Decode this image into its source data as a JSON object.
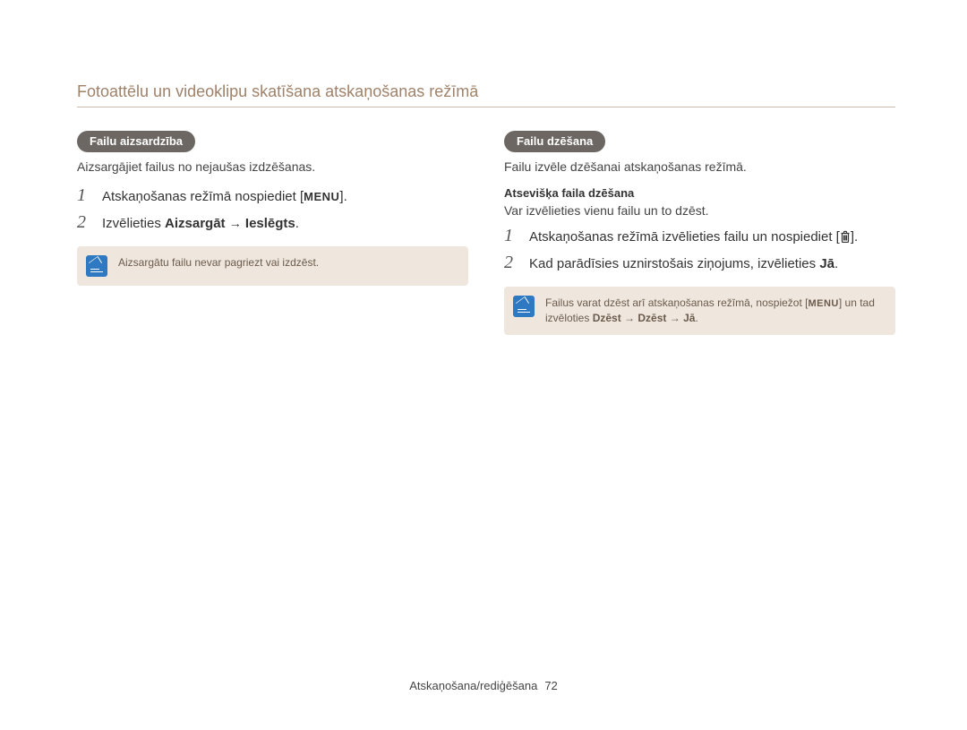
{
  "header": {
    "title": "Fotoattēlu un videoklipu skatīšana atskaņošanas režīmā"
  },
  "left": {
    "pill": "Failu aizsardzība",
    "desc": "Aizsargājiet failus no nejaušas izdzēšanas.",
    "step1_prefix": "Atskaņošanas režīmā nospiediet [",
    "step1_menu": "MENU",
    "step1_suffix": "].",
    "step2_prefix": "Izvēlieties ",
    "step2_strong1": "Aizsargāt",
    "step2_arrow": "→",
    "step2_strong2": "Ieslēgts",
    "step2_suffix": ".",
    "note": "Aizsargātu failu nevar pagriezt vai izdzēst."
  },
  "right": {
    "pill": "Failu dzēšana",
    "desc": "Failu izvēle dzēšanai atskaņošanas režīmā.",
    "subhead": "Atsevišķa faila dzēšana",
    "subdesc": "Var izvēlieties vienu failu un to dzēst.",
    "step1_prefix": "Atskaņošanas režīmā izvēlieties failu un nospiediet [",
    "step1_suffix": "].",
    "step2_prefix": "Kad parādīsies uznirstošais ziņojums, izvēlieties ",
    "step2_strong": "Jā",
    "step2_suffix": ".",
    "note_prefix": "Failus varat dzēst arī atskaņošanas režīmā, nospiežot [",
    "note_menu": "MENU",
    "note_mid": "] un tad izvēloties ",
    "note_s1": "Dzēst",
    "note_a1": "→",
    "note_s2": "Dzēst",
    "note_a2": "→",
    "note_s3": "Jā",
    "note_suffix": "."
  },
  "footer": {
    "section": "Atskaņošana/rediģēšana",
    "page": "72"
  }
}
